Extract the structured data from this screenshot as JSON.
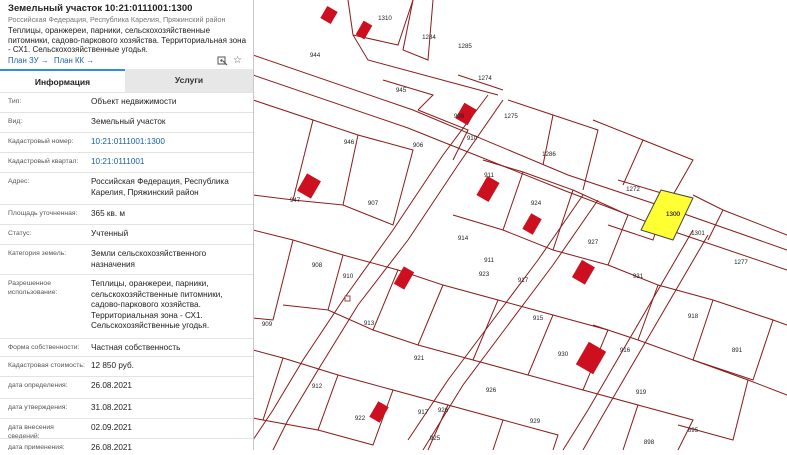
{
  "parcel": {
    "title": "Земельный участок 10:21:0111001:1300",
    "address_line": "Российская Федерация, Республика Карелия, Пряжинский район",
    "description": "Теплицы, оранжереи, парники, сельскохозяйственные питомники, садово-паркового хозяйства. Территориальная зона - СХ1. Сельскохозяйственные угодья."
  },
  "links": {
    "plan_zu": "План ЗУ →",
    "plan_kk": "План КК →"
  },
  "icons": {
    "map": "map-pin-icon",
    "favorite": "star-icon"
  },
  "tabs": {
    "info": "Информация",
    "services": "Услуги"
  },
  "colors": {
    "accent": "#2d8fe0",
    "link": "#1a5fa8",
    "parcel_line": "#8b1a1a",
    "building": "#cc1020",
    "selected_parcel": "#ffff33"
  },
  "fields": [
    {
      "label": "Тип:",
      "value": "Объект недвижимости"
    },
    {
      "label": "Вид:",
      "value": "Земельный участок"
    },
    {
      "label": "Кадастровый номер:",
      "value": "10:21:0111001:1300",
      "link": true
    },
    {
      "label": "Кадастровый квартал:",
      "value": "10:21:0111001",
      "link": true
    },
    {
      "label": "Адрес:",
      "value": "Российская Федерация, Республика Карелия, Пряжинский район"
    },
    {
      "label": "Площадь уточненная:",
      "value": "365 кв. м"
    },
    {
      "label": "Статус:",
      "value": "Учтенный"
    },
    {
      "label": "Категория земель:",
      "value": "Земли сельскохозяйственного назначения"
    },
    {
      "label": "Разрешенное использование:",
      "value": "Теплицы, оранжереи, парники, сельскохозяйственные питомники, садово-паркового хозяйства. Территориальная зона - СХ1. Сельскохозяйственные угодья."
    },
    {
      "label": "Форма собственности:",
      "value": "Частная собственность"
    },
    {
      "label": "Кадастровая стоимость:",
      "value": "12 850 руб."
    },
    {
      "label": "дата определения:",
      "value": "26.08.2021"
    },
    {
      "label": "дата утверждения:",
      "value": "31.08.2021"
    },
    {
      "label": "дата внесения сведений:",
      "value": "02.09.2021"
    },
    {
      "label": "дата применения:",
      "value": "26.08.2021"
    }
  ],
  "map": {
    "selected_label": "1300",
    "labels": [
      "1310",
      "944",
      "1284",
      "1285",
      "1274",
      "945",
      "906",
      "1275",
      "946",
      "906",
      "910",
      "1286",
      "911",
      "947",
      "907",
      "1272",
      "924",
      "1300",
      "1301",
      "914",
      "927",
      "911",
      "908",
      "910",
      "923",
      "931",
      "1277",
      "917",
      "913",
      "915",
      "918",
      "909",
      "921",
      "930",
      "916",
      "891",
      "912",
      "926",
      "919",
      "922",
      "917",
      "926",
      "929",
      "895",
      "925",
      "898"
    ]
  }
}
